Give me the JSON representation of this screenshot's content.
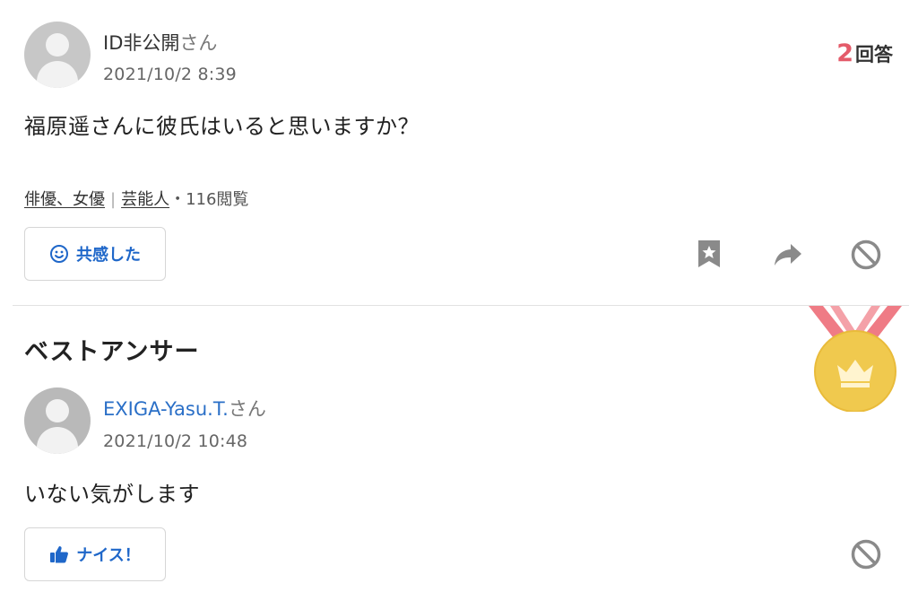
{
  "question": {
    "author_name": "ID非公開",
    "author_suffix": "さん",
    "date": "2021/10/2 8:39",
    "answer_count": "2",
    "answer_label": "回答",
    "text": "福原遥さんに彼氏はいると思いますか？",
    "categories": [
      "俳優、女優",
      "芸能人"
    ],
    "category_separator": "|",
    "views": "・116閲覧",
    "empathy_button": "共感した"
  },
  "best_answer": {
    "section_title": "ベストアンサー",
    "author_name": "EXIGA-Yasu.T.",
    "author_suffix": "さん",
    "date": "2021/10/2 10:48",
    "text": "いない気がします",
    "nice_button": "ナイス！"
  },
  "colors": {
    "accent_blue": "#1f67c9",
    "answer_count_red": "#e45b6a",
    "medal_gold": "#f0c94e",
    "ribbon_pink": "#ef7b85"
  },
  "icons": [
    "smile-icon",
    "bookmark-star-icon",
    "share-arrow-icon",
    "block-icon",
    "thumbs-up-icon",
    "medal-crown-icon",
    "user-avatar-icon"
  ]
}
